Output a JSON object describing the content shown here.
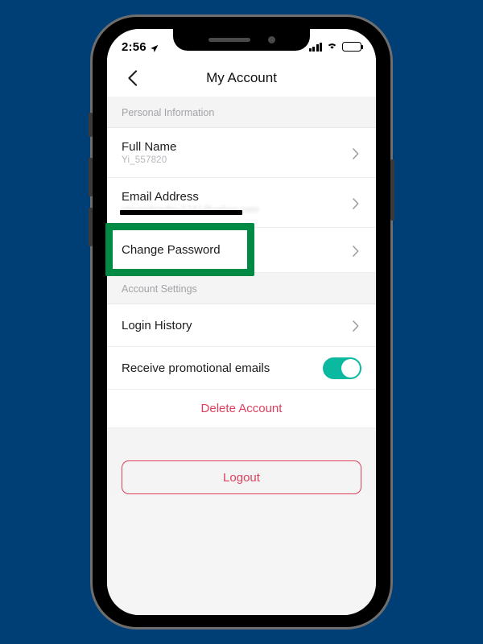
{
  "theme": {
    "page_background": "#003f75",
    "screen_background": "#f5f5f5",
    "accent_green_highlight": "#008a43",
    "toggle_on_color": "#0bb8a0",
    "danger_color": "#e0405e",
    "logout_border_color": "#dd3f5d"
  },
  "status_bar": {
    "time": "2:56",
    "location_icon": "location-arrow-icon",
    "signal_icon": "cellular-signal-icon",
    "wifi_icon": "wifi-icon",
    "battery_icon": "battery-full-icon"
  },
  "navbar": {
    "back_icon": "chevron-left-icon",
    "title": "My Account"
  },
  "sections": [
    {
      "header": "Personal Information",
      "rows": [
        {
          "id": "full-name",
          "title": "Full Name",
          "subtitle": "Yi_557820",
          "accessory": "chevron-right-icon",
          "redacted": false
        },
        {
          "id": "email-address",
          "title": "Email Address",
          "subtitle": "stevenbradley1241@yahoo.com",
          "accessory": "chevron-right-icon",
          "redacted": true
        },
        {
          "id": "change-password",
          "title": "Change Password",
          "subtitle": "",
          "accessory": "chevron-right-icon",
          "redacted": false,
          "highlighted": true
        }
      ]
    },
    {
      "header": "Account Settings",
      "rows": [
        {
          "id": "login-history",
          "title": "Login History",
          "subtitle": "",
          "accessory": "chevron-right-icon",
          "redacted": false
        },
        {
          "id": "promotional-emails",
          "title": "Receive promotional emails",
          "subtitle": "",
          "accessory": "toggle-switch",
          "toggle_state": "on",
          "redacted": false
        },
        {
          "id": "delete-account",
          "title": "Delete Account",
          "subtitle": "",
          "accessory": "none",
          "style": "danger-centered",
          "redacted": false
        }
      ]
    }
  ],
  "logout": {
    "label": "Logout"
  }
}
